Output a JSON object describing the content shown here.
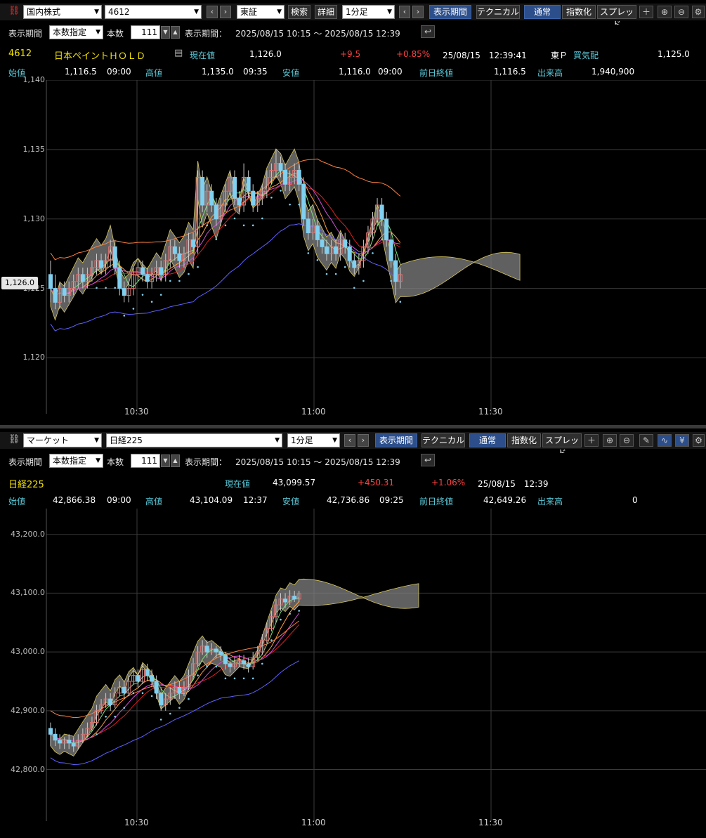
{
  "top": {
    "toolbar": {
      "market_select": "国内株式",
      "code_input": "4612",
      "exchange_select": "東証",
      "search_button": "検索",
      "detail_button": "詳細",
      "interval_select": "1分足",
      "period_button": "表示期間",
      "technical_button": "テクニカル",
      "normal_button": "通常",
      "index_button": "指数化",
      "spread_button": "スプレッド"
    },
    "row2": {
      "period_label": "表示期間",
      "period_mode": "本数指定",
      "count_label": "本数",
      "count_value": "111",
      "range_label": "表示期間：",
      "range_value": "2025/08/15 10:15 ～ 2025/08/15 12:39"
    },
    "quote": {
      "code": "4612",
      "name": "日本ペイントＨＯＬＤ",
      "price_label": "現在値",
      "price": "1,126.0",
      "change": "+9.5",
      "change_pct": "+0.85%",
      "datetime": "25/08/15　12:39:41",
      "market": "東Ｐ",
      "bid_label": "買気配",
      "bid": "1,125.0",
      "open_label": "始値",
      "open": "1,116.5",
      "open_time": "09:00",
      "high_label": "高値",
      "high": "1,135.0",
      "high_time": "09:35",
      "low_label": "安値",
      "low": "1,116.0",
      "low_time": "09:00",
      "prev_label": "前日終値",
      "prev": "1,116.5",
      "volume_label": "出来高",
      "volume": "1,940,900"
    },
    "current_tag": "1,126.0",
    "y_ticks": [
      "1,140",
      "1,135",
      "1,130",
      "1,125",
      "1,120"
    ],
    "x_ticks": [
      "10:30",
      "11:00",
      "11:30"
    ]
  },
  "bottom": {
    "toolbar": {
      "market_select": "マーケット",
      "index_select": "日経225",
      "interval_select": "1分足",
      "period_button": "表示期間",
      "technical_button": "テクニカル",
      "normal_button": "通常",
      "index_button": "指数化",
      "spread_button": "スプレッド"
    },
    "row2": {
      "period_label": "表示期間",
      "period_mode": "本数指定",
      "count_label": "本数",
      "count_value": "111",
      "range_label": "表示期間：",
      "range_value": "2025/08/15 10:15 ～ 2025/08/15 12:39"
    },
    "quote": {
      "name": "日経225",
      "price_label": "現在値",
      "price": "43,099.57",
      "change": "+450.31",
      "change_pct": "+1.06%",
      "datetime": "25/08/15　12:39",
      "open_label": "始値",
      "open": "42,866.38",
      "open_time": "09:00",
      "high_label": "高値",
      "high": "43,104.09",
      "high_time": "12:37",
      "low_label": "安値",
      "low": "42,736.86",
      "low_time": "09:25",
      "prev_label": "前日終値",
      "prev": "42,649.26",
      "volume_label": "出来高",
      "volume": "0"
    },
    "y_ticks": [
      "43,200.0",
      "43,100.0",
      "43,000.0",
      "42,900.0",
      "42,800.0"
    ],
    "x_ticks": [
      "10:30",
      "11:00",
      "11:30"
    ]
  },
  "chart_data": [
    {
      "type": "candlestick",
      "ylim": [
        1118,
        1140
      ],
      "x_ticks": [
        "10:30",
        "11:00",
        "11:30"
      ],
      "y_ticks": [
        1140,
        1135,
        1130,
        1125,
        1120
      ],
      "candles": [
        [
          1126,
          1125,
          1127,
          1124
        ],
        [
          1125,
          1124,
          1126,
          1123.5
        ],
        [
          1124,
          1125,
          1125.5,
          1123.5
        ],
        [
          1125,
          1124.5,
          1125.5,
          1124
        ],
        [
          1124.5,
          1125,
          1125.5,
          1124
        ],
        [
          1125,
          1125.5,
          1126,
          1124.5
        ],
        [
          1125.5,
          1126,
          1126.5,
          1125
        ],
        [
          1126,
          1125.5,
          1126.5,
          1125
        ],
        [
          1125.5,
          1126,
          1126.5,
          1125
        ],
        [
          1126,
          1126.5,
          1127,
          1125.5
        ],
        [
          1126.5,
          1127,
          1127.5,
          1126
        ],
        [
          1127,
          1126.5,
          1127.5,
          1126
        ],
        [
          1126.5,
          1127,
          1127.5,
          1126
        ],
        [
          1127,
          1128,
          1128.5,
          1126.5
        ],
        [
          1128,
          1126.5,
          1128.5,
          1126
        ],
        [
          1126.5,
          1125,
          1127,
          1124.5
        ],
        [
          1125,
          1124.5,
          1125.5,
          1124
        ],
        [
          1124.5,
          1125,
          1125.5,
          1124
        ],
        [
          1125,
          1126,
          1126.5,
          1124.5
        ],
        [
          1126,
          1126.5,
          1127,
          1125.5
        ],
        [
          1126.5,
          1126,
          1127,
          1125.5
        ],
        [
          1126,
          1125.5,
          1126.5,
          1125
        ],
        [
          1125.5,
          1126,
          1126.5,
          1125
        ],
        [
          1126,
          1126.5,
          1127,
          1125.5
        ],
        [
          1126.5,
          1126,
          1127,
          1125.5
        ],
        [
          1126,
          1127,
          1127.5,
          1125.5
        ],
        [
          1127,
          1128,
          1128.5,
          1126.5
        ],
        [
          1128,
          1127.5,
          1128.5,
          1127
        ],
        [
          1127.5,
          1127,
          1128,
          1126.5
        ],
        [
          1127,
          1127.5,
          1128,
          1126.5
        ],
        [
          1127.5,
          1128.5,
          1129,
          1127
        ],
        [
          1128.5,
          1128,
          1129,
          1127.5
        ],
        [
          1128,
          1133,
          1133.5,
          1127.5
        ],
        [
          1133,
          1131,
          1133.5,
          1130.5
        ],
        [
          1131,
          1132,
          1132.5,
          1130.5
        ],
        [
          1132,
          1131,
          1132.5,
          1130.5
        ],
        [
          1131,
          1130,
          1131.5,
          1129.5
        ],
        [
          1130,
          1131,
          1131.5,
          1129.5
        ],
        [
          1131,
          1132,
          1132.5,
          1130.5
        ],
        [
          1132,
          1133,
          1133.5,
          1131.5
        ],
        [
          1133,
          1131.5,
          1133.5,
          1131
        ],
        [
          1131.5,
          1131,
          1132,
          1130.5
        ],
        [
          1131,
          1133,
          1134,
          1130.5
        ],
        [
          1133,
          1132,
          1133.5,
          1131.5
        ],
        [
          1132,
          1131,
          1132.5,
          1130.5
        ],
        [
          1131,
          1131.5,
          1132,
          1130.5
        ],
        [
          1131.5,
          1132,
          1132.5,
          1131
        ],
        [
          1132,
          1133,
          1133.5,
          1131.5
        ],
        [
          1133,
          1133.5,
          1134,
          1132.5
        ],
        [
          1133.5,
          1134,
          1135,
          1133
        ],
        [
          1134,
          1133.5,
          1134.5,
          1133
        ],
        [
          1133.5,
          1132.5,
          1134,
          1132
        ],
        [
          1132.5,
          1133,
          1133.5,
          1132
        ],
        [
          1133,
          1133.5,
          1134,
          1132.5
        ],
        [
          1133.5,
          1132.5,
          1134,
          1132
        ],
        [
          1132.5,
          1130,
          1133,
          1129.5
        ],
        [
          1130,
          1129,
          1130.5,
          1128.5
        ],
        [
          1129,
          1129.5,
          1130,
          1128.5
        ],
        [
          1129.5,
          1128.5,
          1130,
          1128
        ],
        [
          1128.5,
          1128,
          1129,
          1127.5
        ],
        [
          1128,
          1127.5,
          1128.5,
          1127
        ],
        [
          1127.5,
          1128,
          1128.5,
          1127
        ],
        [
          1128,
          1127.5,
          1128.5,
          1127
        ],
        [
          1127.5,
          1128.5,
          1129,
          1127
        ],
        [
          1128.5,
          1128,
          1129,
          1127.5
        ],
        [
          1128,
          1127,
          1128.5,
          1126.5
        ],
        [
          1127,
          1126.5,
          1127.5,
          1126
        ],
        [
          1126.5,
          1127,
          1127.5,
          1126
        ],
        [
          1127,
          1128,
          1128.5,
          1126.5
        ],
        [
          1128,
          1129,
          1129.5,
          1127.5
        ],
        [
          1129,
          1130,
          1130.5,
          1128.5
        ],
        [
          1130,
          1131,
          1131.5,
          1129.5
        ],
        [
          1131,
          1130,
          1131.5,
          1129.5
        ],
        [
          1130,
          1128.5,
          1130.5,
          1128
        ],
        [
          1128.5,
          1127,
          1129,
          1126.5
        ],
        [
          1127,
          1125.5,
          1127.5,
          1124.5
        ],
        [
          1125.5,
          1126,
          1126.5,
          1125
        ]
      ]
    },
    {
      "type": "candlestick",
      "ylim": [
        42760,
        43220
      ],
      "x_ticks": [
        "10:30",
        "11:00",
        "11:30"
      ],
      "y_ticks": [
        43200,
        43100,
        43000,
        42900,
        42800
      ],
      "candles": [
        [
          42870,
          42860,
          42880,
          42840
        ],
        [
          42860,
          42850,
          42870,
          42840
        ],
        [
          42850,
          42845,
          42860,
          42835
        ],
        [
          42845,
          42850,
          42855,
          42835
        ],
        [
          42850,
          42845,
          42860,
          42835
        ],
        [
          42845,
          42840,
          42855,
          42830
        ],
        [
          42840,
          42850,
          42860,
          42835
        ],
        [
          42850,
          42860,
          42870,
          42845
        ],
        [
          42860,
          42870,
          42880,
          42855
        ],
        [
          42870,
          42880,
          42890,
          42865
        ],
        [
          42880,
          42900,
          42910,
          42875
        ],
        [
          42900,
          42910,
          42920,
          42895
        ],
        [
          42910,
          42920,
          42930,
          42905
        ],
        [
          42920,
          42910,
          42930,
          42900
        ],
        [
          42910,
          42930,
          42940,
          42905
        ],
        [
          42930,
          42940,
          42950,
          42925
        ],
        [
          42940,
          42930,
          42950,
          42920
        ],
        [
          42930,
          42950,
          42960,
          42925
        ],
        [
          42950,
          42960,
          42970,
          42945
        ],
        [
          42960,
          42950,
          42970,
          42940
        ],
        [
          42950,
          42970,
          42980,
          42945
        ],
        [
          42970,
          42960,
          42980,
          42950
        ],
        [
          42960,
          42950,
          42970,
          42940
        ],
        [
          42950,
          42930,
          42960,
          42920
        ],
        [
          42930,
          42910,
          42940,
          42900
        ],
        [
          42910,
          42920,
          42930,
          42900
        ],
        [
          42920,
          42930,
          42940,
          42910
        ],
        [
          42930,
          42940,
          42950,
          42920
        ],
        [
          42940,
          42930,
          42950,
          42920
        ],
        [
          42930,
          42940,
          42950,
          42925
        ],
        [
          42940,
          42960,
          42970,
          42935
        ],
        [
          42960,
          42980,
          42990,
          42955
        ],
        [
          42980,
          43000,
          43010,
          42975
        ],
        [
          43000,
          43010,
          43020,
          42995
        ],
        [
          43010,
          43000,
          43020,
          42990
        ],
        [
          43000,
          43005,
          43015,
          42995
        ],
        [
          43005,
          43000,
          43010,
          42990
        ],
        [
          43000,
          42995,
          43010,
          42985
        ],
        [
          42995,
          42980,
          43000,
          42970
        ],
        [
          42980,
          42975,
          42990,
          42965
        ],
        [
          42975,
          42980,
          42990,
          42970
        ],
        [
          42980,
          42985,
          42995,
          42975
        ],
        [
          42985,
          42980,
          42995,
          42970
        ],
        [
          42980,
          42975,
          42990,
          42965
        ],
        [
          42975,
          42990,
          43000,
          42970
        ],
        [
          42990,
          43000,
          43010,
          42985
        ],
        [
          43000,
          43020,
          43030,
          42995
        ],
        [
          43020,
          43040,
          43050,
          43015
        ],
        [
          43040,
          43060,
          43070,
          43035
        ],
        [
          43060,
          43080,
          43090,
          43050
        ],
        [
          43080,
          43090,
          43100,
          43070
        ],
        [
          43090,
          43085,
          43100,
          43075
        ],
        [
          43085,
          43095,
          43105,
          43080
        ],
        [
          43095,
          43090,
          43104,
          43085
        ],
        [
          43090,
          43099,
          43104,
          43085
        ]
      ]
    }
  ]
}
